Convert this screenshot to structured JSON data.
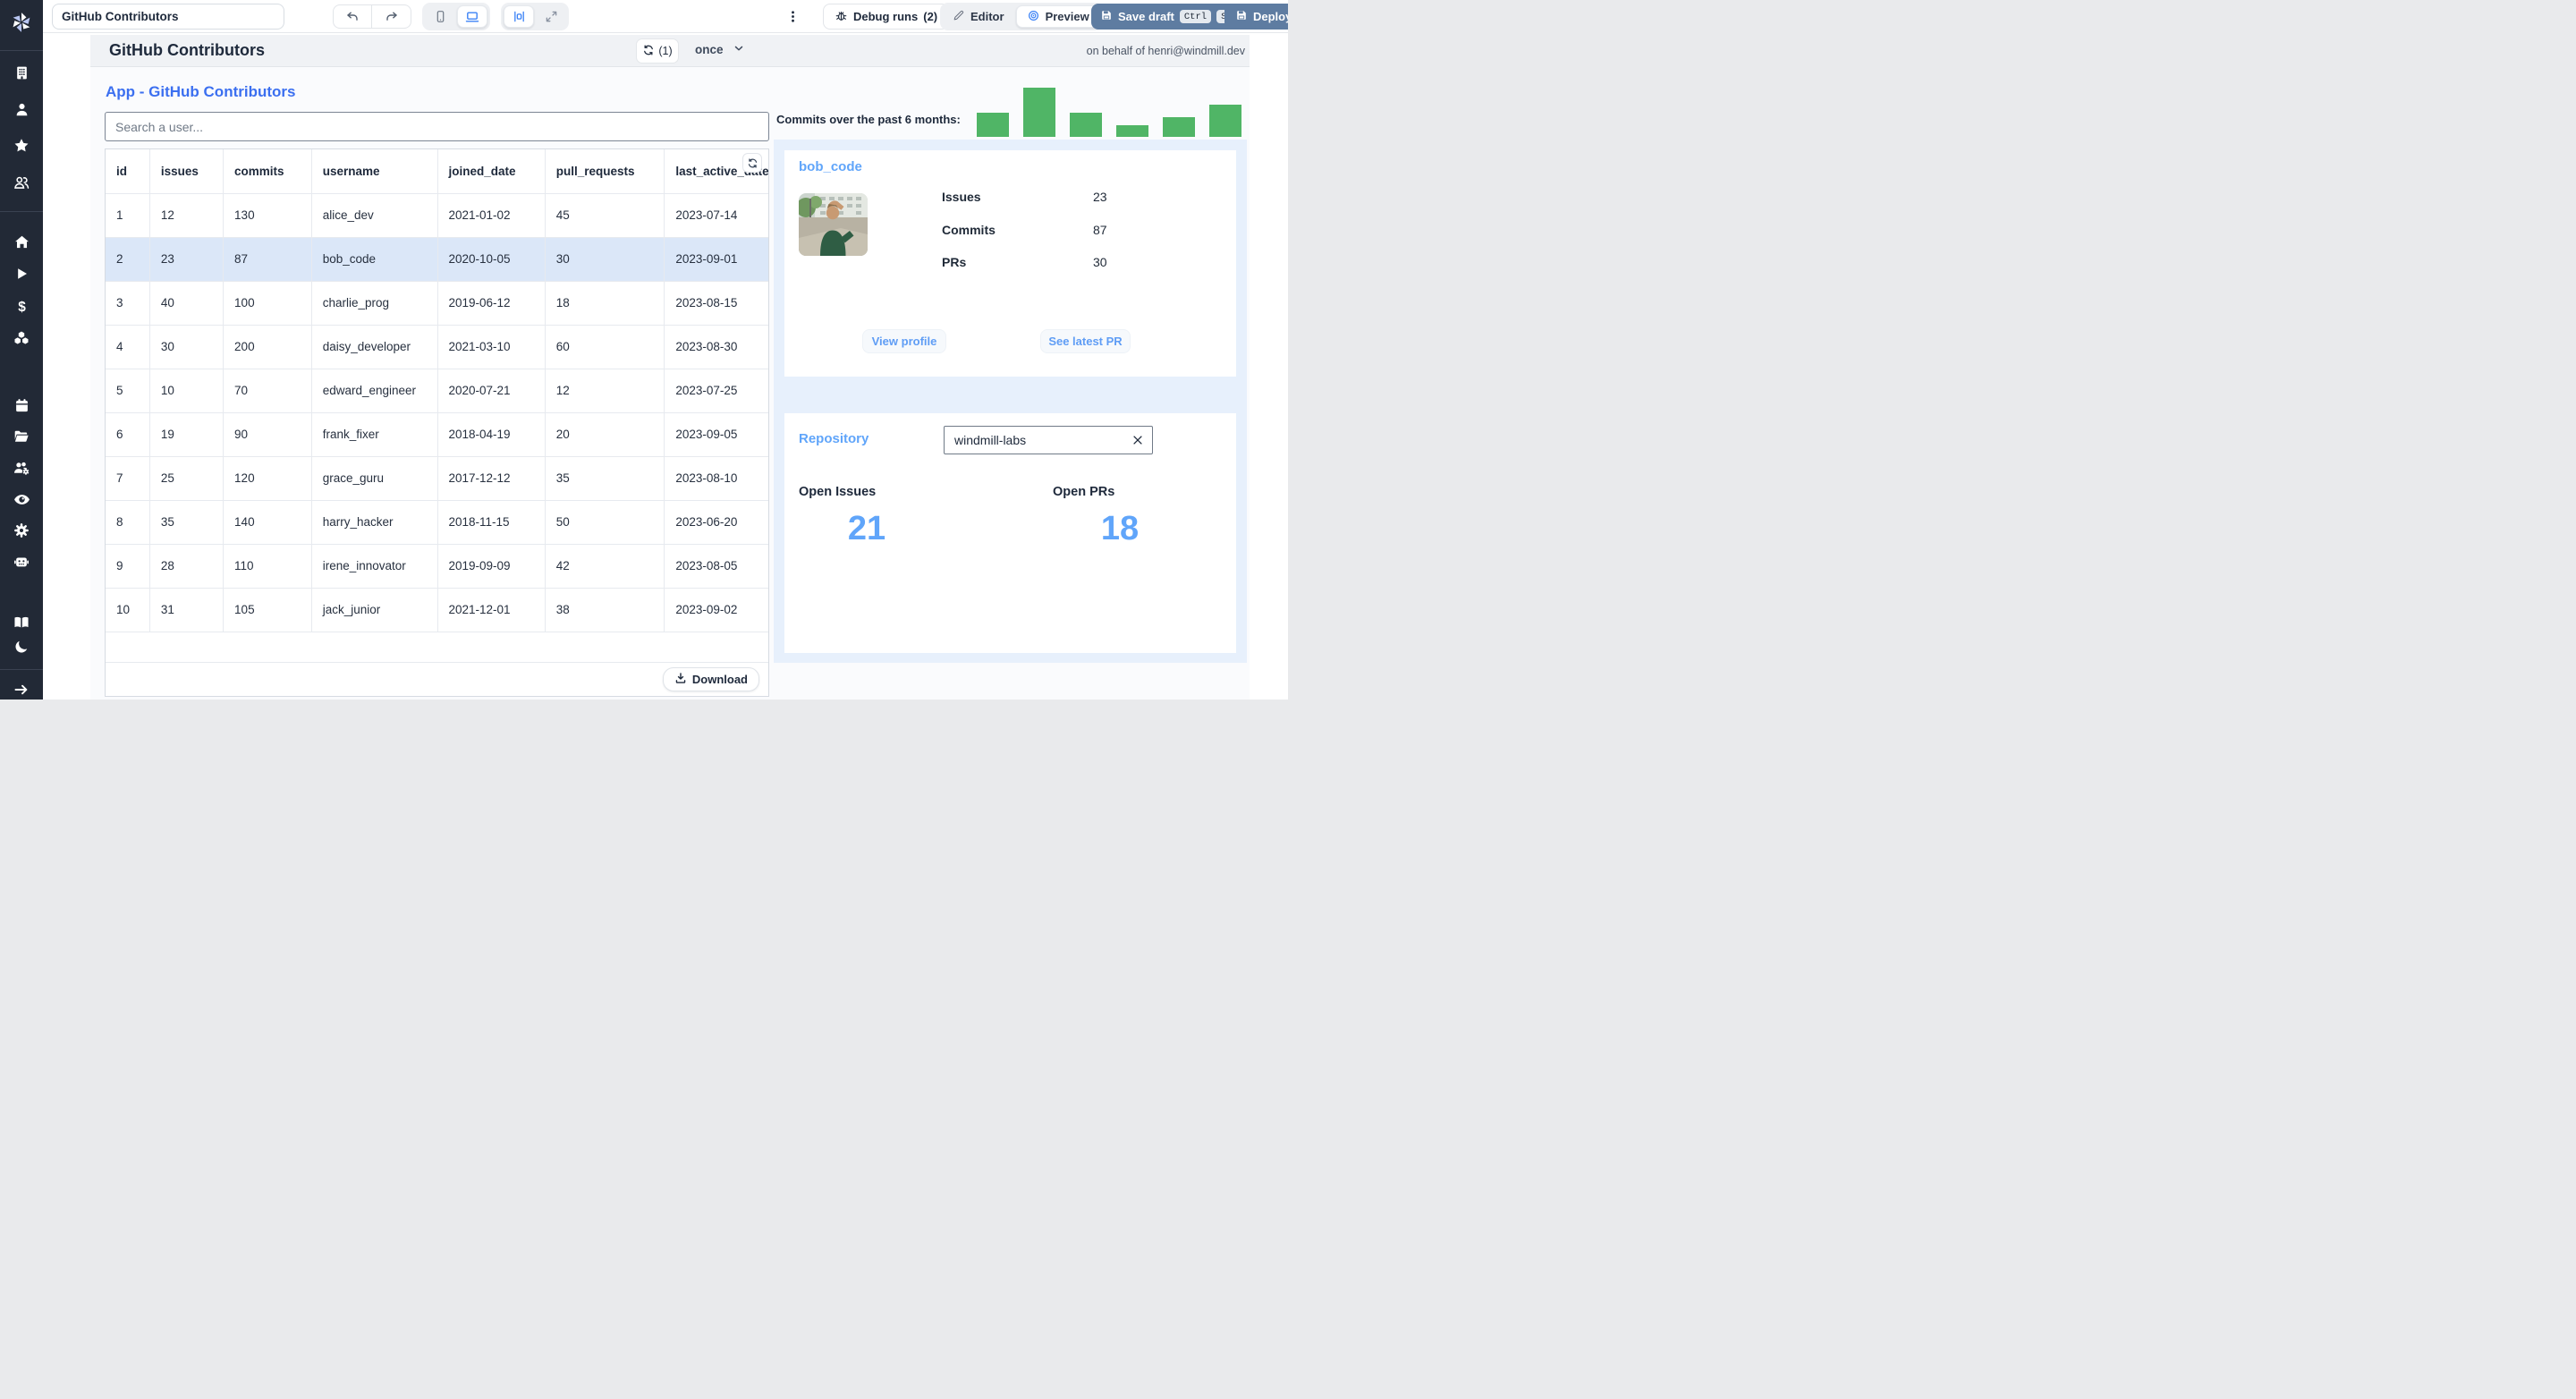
{
  "topbar": {
    "app_name_input": "GitHub Contributors",
    "debug_runs_label": "Debug runs",
    "debug_runs_count": "(2)",
    "editor_label": "Editor",
    "preview_label": "Preview",
    "save_draft_label": "Save draft",
    "kbd_ctrl": "Ctrl",
    "kbd_s": "S",
    "deploy_label": "Deploy"
  },
  "app_header": {
    "title": "GitHub Contributors",
    "refresh_count": "(1)",
    "schedule_label": "once",
    "on_behalf_of": "on behalf of henri@windmill.dev"
  },
  "main": {
    "heading": "App - GitHub Contributors",
    "search_placeholder": "Search a user...",
    "download_label": "Download"
  },
  "table": {
    "columns": [
      "id",
      "issues",
      "commits",
      "username",
      "joined_date",
      "pull_requests",
      "last_active_date"
    ],
    "selected_row_index": 1,
    "rows": [
      [
        "1",
        "12",
        "130",
        "alice_dev",
        "2021-01-02",
        "45",
        "2023-07-14"
      ],
      [
        "2",
        "23",
        "87",
        "bob_code",
        "2020-10-05",
        "30",
        "2023-09-01"
      ],
      [
        "3",
        "40",
        "100",
        "charlie_prog",
        "2019-06-12",
        "18",
        "2023-08-15"
      ],
      [
        "4",
        "30",
        "200",
        "daisy_developer",
        "2021-03-10",
        "60",
        "2023-08-30"
      ],
      [
        "5",
        "10",
        "70",
        "edward_engineer",
        "2020-07-21",
        "12",
        "2023-07-25"
      ],
      [
        "6",
        "19",
        "90",
        "frank_fixer",
        "2018-04-19",
        "20",
        "2023-09-05"
      ],
      [
        "7",
        "25",
        "120",
        "grace_guru",
        "2017-12-12",
        "35",
        "2023-08-10"
      ],
      [
        "8",
        "35",
        "140",
        "harry_hacker",
        "2018-11-15",
        "50",
        "2023-06-20"
      ],
      [
        "9",
        "28",
        "110",
        "irene_innovator",
        "2019-09-09",
        "42",
        "2023-08-05"
      ],
      [
        "10",
        "31",
        "105",
        "jack_junior",
        "2021-12-01",
        "38",
        "2023-09-02"
      ]
    ]
  },
  "chart_data": {
    "type": "bar",
    "title": "Commits over the past 6 months:",
    "values": [
      49,
      100,
      49,
      24,
      40,
      65
    ],
    "unit": "relative-bar-height-percent",
    "bar_color": "#50b566",
    "axes_labels_shown": false
  },
  "user_card": {
    "username": "bob_code",
    "avatar_icon": "bob-avatar-photo",
    "stats": [
      {
        "label": "Issues",
        "value": "23"
      },
      {
        "label": "Commits",
        "value": "87"
      },
      {
        "label": "PRs",
        "value": "30"
      }
    ],
    "view_profile_label": "View profile",
    "see_latest_pr_label": "See latest PR"
  },
  "repo_card": {
    "heading": "Repository",
    "input_value": "windmill-labs",
    "metrics": [
      {
        "label": "Open Issues",
        "value": "21"
      },
      {
        "label": "Open PRs",
        "value": "18"
      }
    ]
  },
  "sidebar": {
    "groups": [
      [
        "building",
        "user",
        "star",
        "users"
      ],
      [
        "home",
        "play",
        "dollar",
        "cubes"
      ],
      [
        "calendar",
        "folder",
        "users-gear",
        "eye",
        "gear",
        "robot"
      ],
      [
        "book",
        "moon"
      ],
      [
        "arrow-right"
      ]
    ]
  },
  "colors": {
    "accent_blue": "#3b6ff0",
    "light_blue_heading": "#60a5fa",
    "bar_green": "#50b566",
    "slate_button": "#5e7ca1",
    "selected_row": "#dbe7f8",
    "sidebar_bg": "#222936",
    "panel_blue_bg": "#e7f0fc"
  }
}
